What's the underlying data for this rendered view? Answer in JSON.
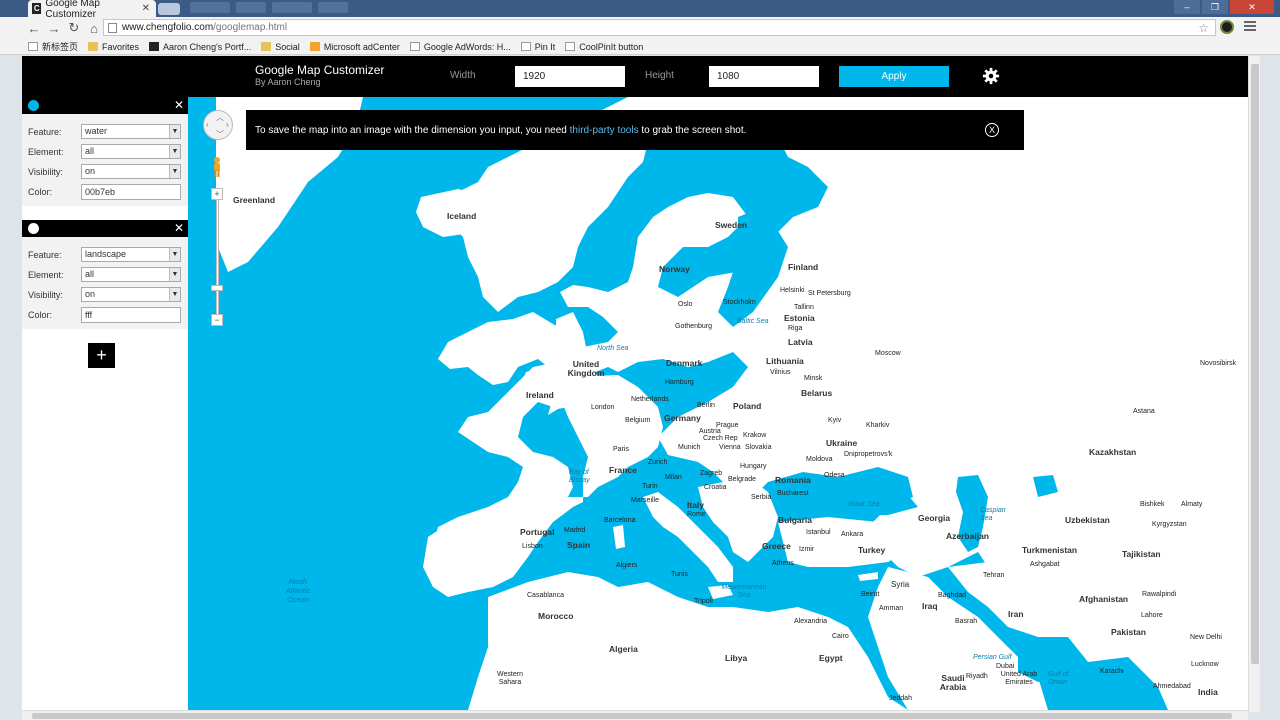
{
  "browser": {
    "tab_title": "Google Map Customizer",
    "tab_favicon": "C",
    "url_host": "www.chengfolio.com",
    "url_path": "/googlemap.html",
    "bookmarks": [
      {
        "label": "新标签页",
        "icon": "page"
      },
      {
        "label": "Favorites",
        "icon": "folder"
      },
      {
        "label": "Aaron Cheng's Portf...",
        "icon": "c"
      },
      {
        "label": "Social",
        "icon": "folder"
      },
      {
        "label": "Microsoft adCenter",
        "icon": "orange"
      },
      {
        "label": "Google AdWords: H...",
        "icon": "page"
      },
      {
        "label": "Pin It",
        "icon": "page"
      },
      {
        "label": "CoolPinIt button",
        "icon": "page"
      }
    ]
  },
  "header": {
    "title": "Google Map Customizer",
    "subtitle": "By Aaron Cheng",
    "width_label": "Width",
    "width_value": "1920",
    "height_label": "Height",
    "height_value": "1080",
    "apply_label": "Apply"
  },
  "styles": [
    {
      "dot_color": "#00b7eb",
      "feature_label": "Feature:",
      "feature": "water",
      "element_label": "Element:",
      "element": "all",
      "visibility_label": "Visibility:",
      "visibility": "on",
      "color_label": "Color:",
      "color": "00b7eb"
    },
    {
      "dot_color": "#ffffff",
      "feature_label": "Feature:",
      "feature": "landscape",
      "element_label": "Element:",
      "element": "all",
      "visibility_label": "Visibility:",
      "visibility": "on",
      "color_label": "Color:",
      "color": "fff"
    }
  ],
  "add_label": "+",
  "notice": {
    "before": "To save the map into an image with the dimension you input, you need ",
    "link": "third-party tools",
    "after": " to grab the screen shot.",
    "close": "X"
  },
  "map": {
    "water_color": "#00b7eb",
    "land_color": "#ffffff",
    "countries": [
      "Greenland",
      "Iceland",
      "Sweden",
      "Norway",
      "Finland",
      "Estonia",
      "Latvia",
      "Lithuania",
      "United Kingdom",
      "Ireland",
      "Denmark",
      "Belarus",
      "Poland",
      "Germany",
      "Ukraine",
      "France",
      "Romania",
      "Italy",
      "Bulgaria",
      "Portugal",
      "Spain",
      "Greece",
      "Turkey",
      "Georgia",
      "Azerbaijan",
      "Kazakhstan",
      "Uzbekistan",
      "Turkmenistan",
      "Tajikistan",
      "Syria",
      "Iraq",
      "Iran",
      "Afghanistan",
      "Pakistan",
      "Morocco",
      "Algeria",
      "Libya",
      "Egypt",
      "Saudi Arabia",
      "India",
      "Western Sahara",
      "United Arab Emirates",
      "Kyrgyzstan",
      "Croatia",
      "Serbia",
      "Hungary",
      "Austria",
      "Czech Rep",
      "Slovakia",
      "Moldova",
      "Netherlands",
      "Belgium"
    ],
    "cities": [
      "Oslo",
      "Stockholm",
      "Helsinki",
      "St Petersburg",
      "Tallinn",
      "Gothenburg",
      "Riga",
      "Vilnius",
      "Minsk",
      "Moscow",
      "Hamburg",
      "Berlin",
      "Prague",
      "Krakow",
      "Kyiv",
      "Kharkiv",
      "Dnipropetrovs'k",
      "London",
      "Paris",
      "Munich",
      "Vienna",
      "Zurich",
      "Milan",
      "Turin",
      "Zagreb",
      "Belgrade",
      "Bucharest",
      "Odesa",
      "Marseille",
      "Rome",
      "Barcelona",
      "Madrid",
      "Lisbon",
      "Istanbul",
      "Ankara",
      "Izmir",
      "Athens",
      "Algiers",
      "Tunis",
      "Casablanca",
      "Tripoli",
      "Alexandria",
      "Cairo",
      "Amman",
      "Beirut",
      "Baghdad",
      "Basrah",
      "Tehran",
      "Ashgabat",
      "Astana",
      "Bishkek",
      "Almaty",
      "Novosibirsk",
      "Rawalpindi",
      "Lahore",
      "New Delhi",
      "Lucknow",
      "Karachi",
      "Ahmedabad",
      "Jeddah",
      "Riyadh",
      "Dubai"
    ],
    "seas": [
      "North Sea",
      "Baltic Sea",
      "Bay of Biscay",
      "Black Sea",
      "Caspian Sea",
      "Mediterranean Sea",
      "Persian Gulf",
      "Gulf of Oman"
    ],
    "ocean": "North Atlantic Ocean"
  }
}
